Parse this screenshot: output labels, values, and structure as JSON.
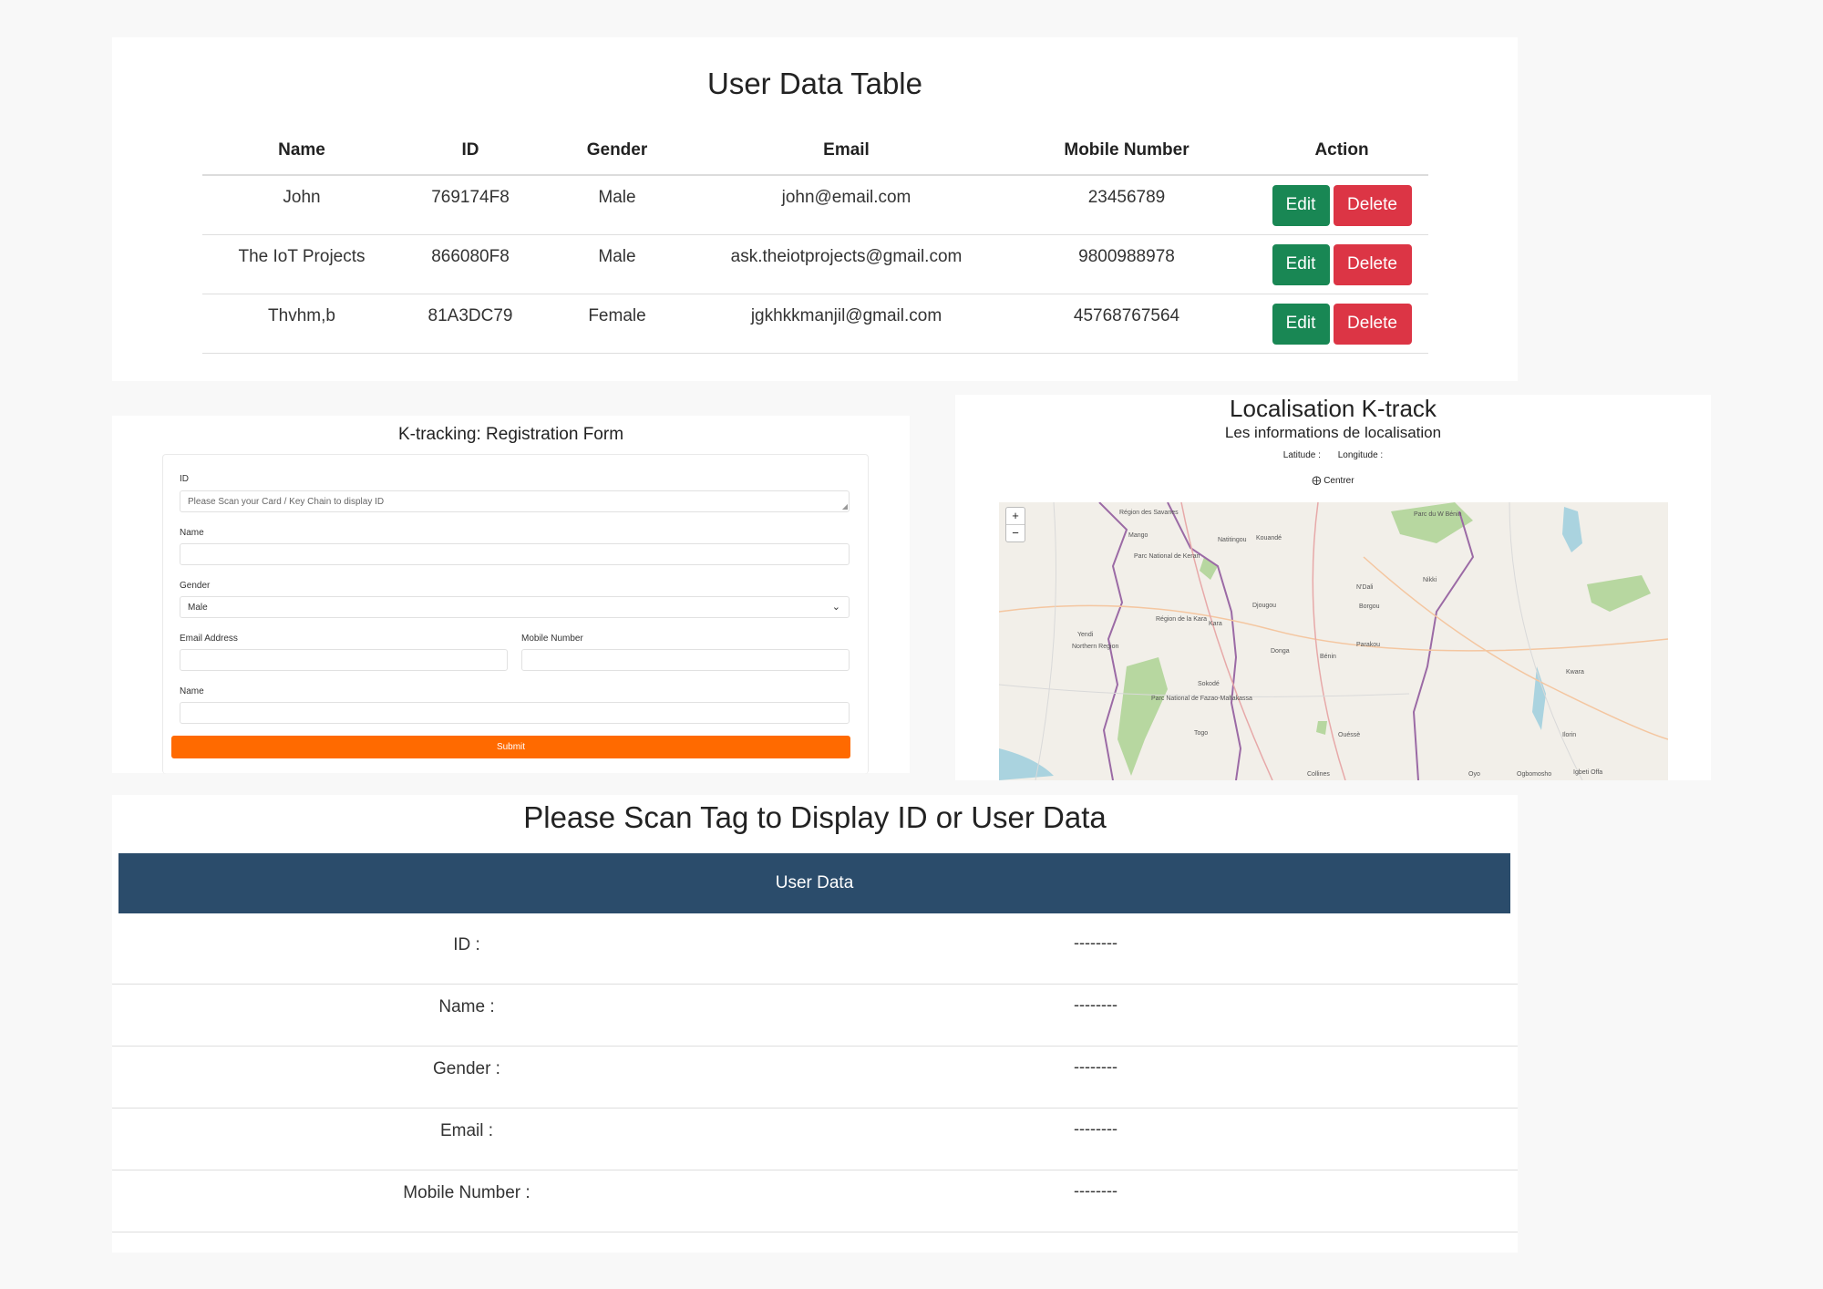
{
  "user_table": {
    "title": "User Data Table",
    "columns": [
      "Name",
      "ID",
      "Gender",
      "Email",
      "Mobile Number",
      "Action"
    ],
    "rows": [
      {
        "name": "John",
        "id": "769174F8",
        "gender": "Male",
        "email": "john@email.com",
        "mobile": "23456789"
      },
      {
        "name": "The IoT Projects",
        "id": "866080F8",
        "gender": "Male",
        "email": "ask.theiotprojects@gmail.com",
        "mobile": "9800988978"
      },
      {
        "name": "Thvhm,b",
        "id": "81A3DC79",
        "gender": "Female",
        "email": "jgkhkkmanjil@gmail.com",
        "mobile": "45768767564"
      }
    ],
    "edit_label": "Edit",
    "delete_label": "Delete",
    "colors": {
      "edit": "#198754",
      "delete": "#dc3545"
    }
  },
  "registration_form": {
    "title": "K-tracking: Registration Form",
    "id_label": "ID",
    "id_placeholder": "Please Scan your Card / Key Chain to display ID",
    "name_label": "Name",
    "gender_label": "Gender",
    "gender_selected": "Male",
    "email_label": "Email Address",
    "mobile_label": "Mobile Number",
    "name2_label": "Name",
    "submit_label": "Submit",
    "submit_color": "#ff6a00"
  },
  "localisation": {
    "title": "Localisation K-track",
    "subtitle": "Les informations de localisation",
    "latitude_label": "Latitude :",
    "longitude_label": "Longitude :",
    "center_icon": "crosshair-icon",
    "center_label": "Centrer",
    "zoom_in": "+",
    "zoom_out": "−",
    "map_labels": [
      "Région des Savanes",
      "Mango",
      "Parc National de Keran",
      "Natitingou",
      "Kouandé",
      "Parc du W Bénin",
      "N'Dali",
      "Nikki",
      "Djougou",
      "Borgou",
      "Région de la Kara",
      "Kara",
      "Yendi",
      "Northern Region",
      "Donga",
      "Parakou",
      "Bénin",
      "Sokodé",
      "Parc National de Fazao-Malfakassa",
      "Togo",
      "Ouéssè",
      "Ilorin",
      "Kwara",
      "Collines",
      "Ogbomosho",
      "Igbeti Offa",
      "Oyo"
    ]
  },
  "scan_panel": {
    "title": "Please Scan Tag to Display ID or User Data",
    "header": "User Data",
    "header_color": "#2b4c6b",
    "rows": [
      {
        "label": "ID :",
        "value": "--------"
      },
      {
        "label": "Name :",
        "value": "--------"
      },
      {
        "label": "Gender :",
        "value": "--------"
      },
      {
        "label": "Email :",
        "value": "--------"
      },
      {
        "label": "Mobile Number :",
        "value": "--------"
      }
    ]
  }
}
